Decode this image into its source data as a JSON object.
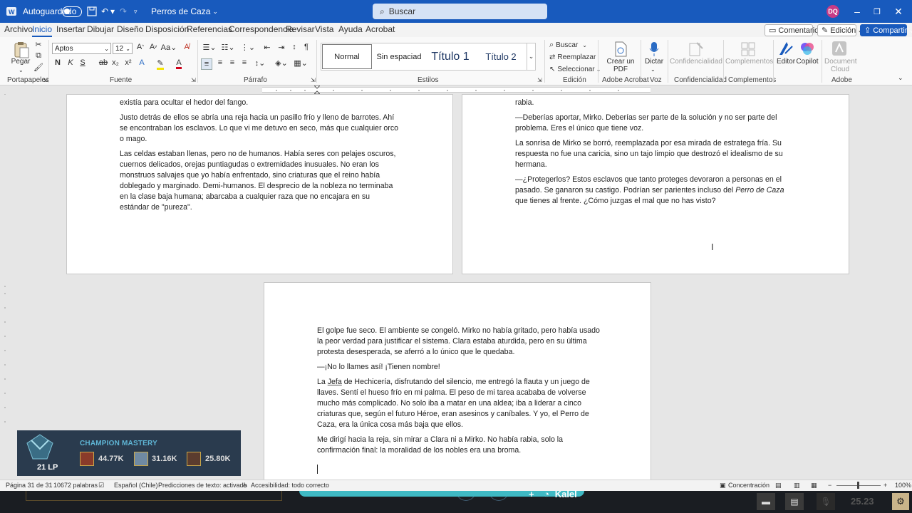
{
  "titlebar": {
    "autosave_label": "Autoguardado",
    "doc_title": "Perros de Caza",
    "search_placeholder": "Buscar",
    "user_initials": "DQ"
  },
  "menu": {
    "tabs": [
      "Archivo",
      "Inicio",
      "Insertar",
      "Dibujar",
      "Diseño",
      "Disposición",
      "Referencias",
      "Correspondencia",
      "Revisar",
      "Vista",
      "Ayuda",
      "Acrobat"
    ],
    "active_tab": "Inicio",
    "comments_label": "Comentarios",
    "editing_label": "Edición",
    "share_label": "Compartir"
  },
  "ribbon": {
    "paste_label": "Pegar",
    "font_name": "Aptos",
    "font_size": "12",
    "styles": [
      "Normal",
      "Sin espaciad",
      "Título 1",
      "Título 2"
    ],
    "find_label": "Buscar",
    "replace_label": "Reemplazar",
    "select_label": "Seleccionar",
    "create_pdf_label": "Crear un PDF",
    "dictate_label": "Dictar",
    "confidentiality_btn": "Confidencialidad",
    "addins_btn": "Complementos",
    "editor_label": "Editor",
    "copilot_label": "Copilot",
    "doc_cloud_label": "Document Cloud",
    "groups": {
      "clipboard": "Portapapeles",
      "font": "Fuente",
      "paragraph": "Párrafo",
      "styles": "Estilos",
      "editing": "Edición",
      "acrobat": "Adobe Acrobat",
      "voice": "Voz",
      "confidentiality": "Confidencialidad",
      "addins": "Complementos",
      "adobe": "Adobe"
    }
  },
  "document": {
    "page_left": [
      "existía para ocultar el hedor del fango.",
      "Justo detrás de ellos se abría una reja hacia un pasillo frío y lleno de barrotes. Ahí se encontraban los esclavos. Lo que vi me detuvo en seco, más que cualquier orco o mago.",
      "Las celdas estaban llenas, pero no de humanos. Había seres con pelajes oscuros, cuernos delicados, orejas puntiagudas o extremidades inusuales. No eran los monstruos salvajes que yo había enfrentado, sino criaturas que el reino había doblegado y marginado. Demi-humanos. El desprecio de la nobleza no terminaba en la clase baja humana; abarcaba a cualquier raza que no encajara en su estándar de \"pureza\"."
    ],
    "page_right": {
      "p0": "rabia.",
      "p1": "—Deberías aportar, Mirko. Deberías ser parte de la solución y no ser parte del problema. Eres el único que tiene voz.",
      "p2": "La sonrisa de Mirko se borró, reemplazada por esa mirada de estratega fría. Su respuesta no fue una caricia, sino un tajo limpio que destrozó el idealismo de su hermana.",
      "p3_a": "—¿Protegerlos? Estos esclavos que tanto proteges devoraron a personas en el pasado. Se ganaron su castigo. Podrían ser parientes incluso del ",
      "p3_em": "Perro de Caza",
      "p3_b": " que tienes al frente. ¿Cómo juzgas el mal que no has visto?"
    },
    "page_bottom": {
      "p1": "El golpe fue seco. El ambiente se congeló. Mirko no había gritado, pero había usado la peor verdad para justificar el sistema. Clara estaba aturdida, pero en su última protesta desesperada, se aferró a lo único que le quedaba.",
      "p2": "—¡No lo llames así! ¡Tienen nombre!",
      "p3_a": "La ",
      "p3_u": "Jefa",
      "p3_b": " de Hechicería, disfrutando del silencio, me entregó la flauta y un juego de llaves. Sentí el hueso frío en mi palma. El peso de mi tarea acababa de volverse mucho más complicado. No solo iba a matar en una aldea; iba a liderar a cinco criaturas que, según el futuro Héroe, eran asesinos y caníbales. Y yo, el Perro de Caza, era la única cosa más baja que ellos.",
      "p4": "Me dirigí hacia la reja, sin mirar a Clara ni a Mirko. No había rabia, solo la confirmación final: la moralidad de los nobles era una broma."
    }
  },
  "overlay": {
    "title": "CHAMPION MASTERY",
    "lp": "21 LP",
    "values": [
      "44.77K",
      "31.16K",
      "25.80K"
    ]
  },
  "statusbar": {
    "page": "Página 31 de 31",
    "words": "10672 palabras",
    "language": "Español (Chile)",
    "predictions": "Predicciones de texto: activado",
    "accessibility": "Accesibilidad: todo correcto",
    "focus": "Concentración",
    "zoom": "100%"
  },
  "taskbar": {
    "game_name": "Kalel",
    "clock": "25.23"
  }
}
